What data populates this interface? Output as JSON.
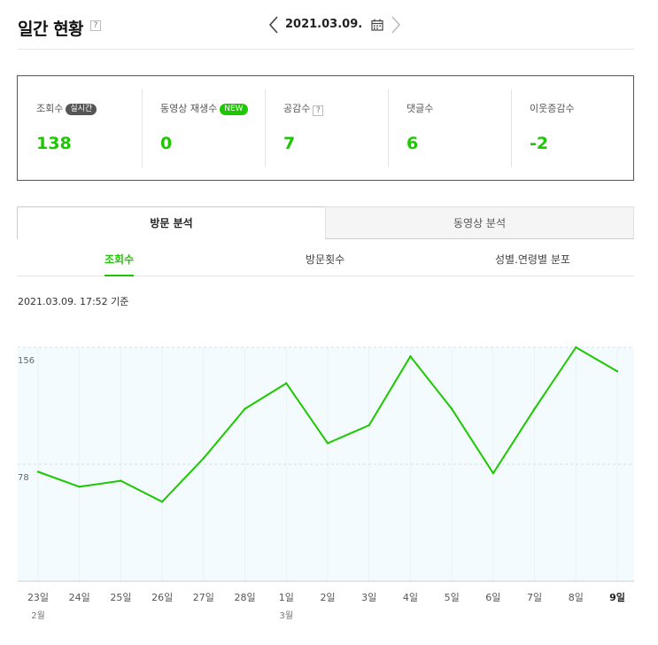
{
  "header": {
    "title": "일간 현황",
    "help": "?",
    "date": "2021.03.09."
  },
  "stats": [
    {
      "label": "조회수",
      "badge": "실시간",
      "badge_style": "live",
      "value": "138"
    },
    {
      "label": "동영상 재생수",
      "badge": "NEW",
      "badge_style": "new",
      "value": "0"
    },
    {
      "label": "공감수",
      "help": "?",
      "value": "7"
    },
    {
      "label": "댓글수",
      "value": "6"
    },
    {
      "label": "이웃증감수",
      "value": "-2"
    }
  ],
  "main_tabs": {
    "active": "방문 분석",
    "inactive": "동영상 분석"
  },
  "sub_tabs": [
    "조회수",
    "방문횟수",
    "성별.연령별 분포"
  ],
  "as_of": "2021.03.09. 17:52 기준",
  "colors": {
    "accent": "#1ec800",
    "chart_fill": "#f3fbfe"
  },
  "chart_data": {
    "type": "line",
    "x": [
      "23일",
      "24일",
      "25일",
      "26일",
      "27일",
      "28일",
      "1일",
      "2일",
      "3일",
      "4일",
      "5일",
      "6일",
      "7일",
      "8일",
      "9일"
    ],
    "month_labels": [
      {
        "at": "23일",
        "label": "2월"
      },
      {
        "at": "1일",
        "label": "3월"
      }
    ],
    "series": [
      {
        "values": [
          73,
          63,
          67,
          53,
          82,
          115,
          132,
          92,
          104,
          150,
          115,
          72,
          115,
          156,
          140
        ]
      }
    ],
    "ylim": [
      0,
      156
    ],
    "yticks": [
      78,
      156
    ],
    "grid": true
  }
}
